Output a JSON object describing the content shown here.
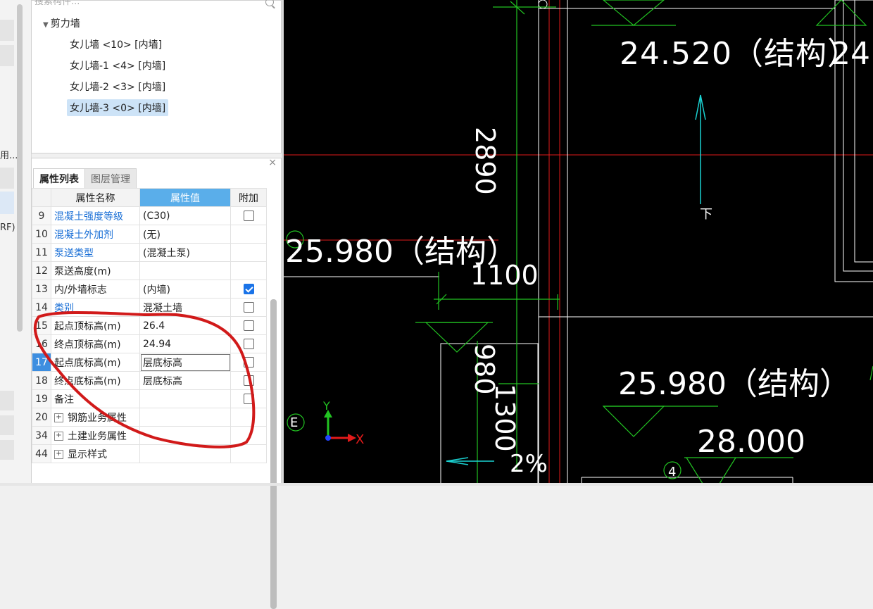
{
  "left_strip": {
    "label_1": "用...",
    "label_2": "RF)"
  },
  "component_tree": {
    "search_placeholder": "搜索构件...",
    "category": "剪力墙",
    "items": [
      {
        "label": "女儿墙 <10> [内墙]"
      },
      {
        "label": "女儿墙-1 <4> [内墙]"
      },
      {
        "label": "女儿墙-2 <3> [内墙]"
      },
      {
        "label": "女儿墙-3 <0> [内墙]",
        "selected": true
      }
    ]
  },
  "properties_panel": {
    "tabs": [
      {
        "label": "属性列表",
        "active": true
      },
      {
        "label": "图层管理",
        "active": false
      }
    ],
    "columns": {
      "name": "属性名称",
      "value": "属性值",
      "extra": "附加"
    },
    "rows": [
      {
        "num": "9",
        "name": "混凝土强度等级",
        "value": "(C30)",
        "blue": true,
        "checkbox": "unchecked"
      },
      {
        "num": "10",
        "name": "混凝土外加剂",
        "value": "(无)",
        "blue": true,
        "checkbox": "none"
      },
      {
        "num": "11",
        "name": "泵送类型",
        "value": "(混凝土泵)",
        "blue": true,
        "checkbox": "none"
      },
      {
        "num": "12",
        "name": "泵送高度(m)",
        "value": "",
        "blue": false,
        "checkbox": "none"
      },
      {
        "num": "13",
        "name": "内/外墙标志",
        "value": "(内墙)",
        "blue": false,
        "checkbox": "checked"
      },
      {
        "num": "14",
        "name": "类别",
        "value": "混凝土墙",
        "blue": true,
        "checkbox": "unchecked"
      },
      {
        "num": "15",
        "name": "起点顶标高(m)",
        "value": "26.4",
        "blue": false,
        "checkbox": "unchecked"
      },
      {
        "num": "16",
        "name": "终点顶标高(m)",
        "value": "24.94",
        "blue": false,
        "checkbox": "unchecked"
      },
      {
        "num": "17",
        "name": "起点底标高(m)",
        "value": "层底标高",
        "blue": false,
        "checkbox": "unchecked",
        "selected": true
      },
      {
        "num": "18",
        "name": "终点底标高(m)",
        "value": "层底标高",
        "blue": false,
        "checkbox": "unchecked"
      },
      {
        "num": "19",
        "name": "备注",
        "value": "",
        "blue": false,
        "checkbox": "unchecked"
      },
      {
        "num": "20",
        "name": "钢筋业务属性",
        "value": "",
        "blue": false,
        "checkbox": "none",
        "group": true
      },
      {
        "num": "34",
        "name": "土建业务属性",
        "value": "",
        "blue": false,
        "checkbox": "none",
        "group": true
      },
      {
        "num": "44",
        "name": "显示样式",
        "value": "",
        "blue": false,
        "checkbox": "none",
        "group": true
      }
    ]
  },
  "cad": {
    "elev_1": "24.520（结构）",
    "elev_partial": "24.",
    "elev_2": "25.980（结构）",
    "elev_3": "25.980（结构）",
    "elev_4": "28.000",
    "dim_2890": "2890",
    "dim_1100": "1100",
    "dim_980": "980",
    "dim_1300": "1300",
    "slope": "2%",
    "label_xia": "下",
    "axis_e": "E",
    "axis_4": "4",
    "ucs_x": "X",
    "ucs_y": "Y",
    "colors": {
      "green": "#22c322",
      "white": "#ffffff",
      "red": "#e11a1a",
      "cyan": "#1ad1d1",
      "blue": "#2244ff"
    }
  }
}
